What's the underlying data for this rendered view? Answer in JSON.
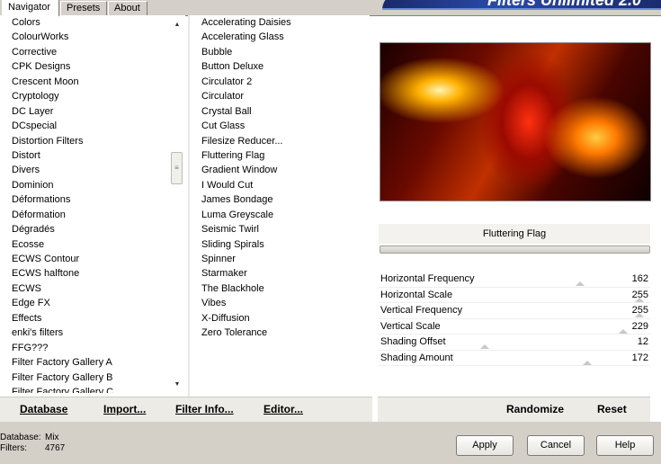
{
  "tabs": [
    "Navigator",
    "Presets",
    "About"
  ],
  "logo_text": "Filters Unlimited 2.0",
  "categories": [
    "Colors",
    "ColourWorks",
    "Corrective",
    "CPK Designs",
    "Crescent Moon",
    "Cryptology",
    "DC Layer",
    "DCspecial",
    "Distortion Filters",
    "Distort",
    "Divers",
    "Dominion",
    "Déformations",
    "Déformation",
    "Dégradés",
    "Ecosse",
    "ECWS Contour",
    "ECWS halftone",
    "ECWS",
    "Edge FX",
    "Effects",
    "enki's filters",
    "FFG???",
    "Filter Factory Gallery A",
    "Filter Factory Gallery B",
    "Filter Factory Gallery C"
  ],
  "filters": [
    "Accelerating Daisies",
    "Accelerating Glass",
    "Bubble",
    "Button Deluxe",
    "Circulator 2",
    "Circulator",
    "Crystal Ball",
    "Cut Glass",
    "Filesize Reducer...",
    "Fluttering Flag",
    "Gradient Window",
    "I Would Cut",
    "James Bondage",
    "Luma Greyscale",
    "Seismic Twirl",
    "Sliding Spirals",
    "Spinner",
    "Starmaker",
    "The Blackhole",
    "Vibes",
    "X-Diffusion",
    "Zero Tolerance"
  ],
  "selected_filter": "Fluttering Flag",
  "parameters": [
    {
      "label": "Horizontal Frequency",
      "value": "162",
      "level": 0.635
    },
    {
      "label": "Horizontal Scale",
      "value": "255",
      "level": 1.0
    },
    {
      "label": "Vertical Frequency",
      "value": "255",
      "level": 1.0
    },
    {
      "label": "Vertical Scale",
      "value": "229",
      "level": 0.898
    },
    {
      "label": "Shading Offset",
      "value": "12",
      "level": 0.047
    },
    {
      "label": "Shading Amount",
      "value": "172",
      "level": 0.675
    }
  ],
  "bottom_left": {
    "database": "Database",
    "import": "Import...",
    "filter_info": "Filter Info...",
    "editor": "Editor..."
  },
  "bottom_right": {
    "randomize": "Randomize",
    "reset": "Reset"
  },
  "status": {
    "database_label": "Database:",
    "database_value": "Mix",
    "filters_label": "Filters:",
    "filters_value": "4767"
  },
  "buttons": {
    "apply": "Apply",
    "cancel": "Cancel",
    "help": "Help"
  }
}
